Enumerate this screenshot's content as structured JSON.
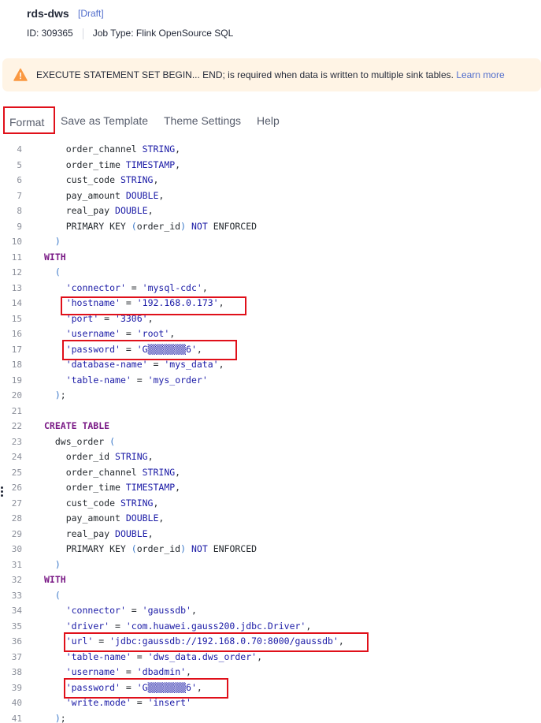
{
  "header": {
    "job_name": "rds-dws",
    "status": "[Draft]",
    "id_text": "ID: 309365",
    "job_type_text": "Job Type: Flink OpenSource SQL"
  },
  "banner": {
    "icon": "warning-icon",
    "message": "EXECUTE STATEMENT SET BEGIN... END; is required when data is written to multiple sink tables.",
    "link": "Learn more",
    "color": "#fff4e5"
  },
  "toolbar": {
    "format": "Format",
    "save_template": "Save as Template",
    "theme_settings": "Theme Settings",
    "help": "Help"
  },
  "editor": {
    "lines": [
      {
        "n": "4",
        "t": "    order_channel STRING,"
      },
      {
        "n": "5",
        "t": "    order_time TIMESTAMP,"
      },
      {
        "n": "6",
        "t": "    cust_code STRING,"
      },
      {
        "n": "7",
        "t": "    pay_amount DOUBLE,"
      },
      {
        "n": "8",
        "t": "    real_pay DOUBLE,"
      },
      {
        "n": "9",
        "t": "    PRIMARY KEY (order_id) NOT ENFORCED"
      },
      {
        "n": "10",
        "t": "  )"
      },
      {
        "n": "11",
        "t": "WITH"
      },
      {
        "n": "12",
        "t": "  ("
      },
      {
        "n": "13",
        "t": "    'connector' = 'mysql-cdc',"
      },
      {
        "n": "14",
        "t": "    'hostname' = '192.168.0.173',"
      },
      {
        "n": "15",
        "t": "    'port' = '3306',"
      },
      {
        "n": "16",
        "t": "    'username' = 'root',"
      },
      {
        "n": "17",
        "t": "    'password' = 'G▒▒▒▒▒▒▒6',"
      },
      {
        "n": "18",
        "t": "    'database-name' = 'mys_data',"
      },
      {
        "n": "19",
        "t": "    'table-name' = 'mys_order'"
      },
      {
        "n": "20",
        "t": "  );"
      },
      {
        "n": "21",
        "t": ""
      },
      {
        "n": "22",
        "t": "CREATE TABLE"
      },
      {
        "n": "23",
        "t": "  dws_order ("
      },
      {
        "n": "24",
        "t": "    order_id STRING,"
      },
      {
        "n": "25",
        "t": "    order_channel STRING,"
      },
      {
        "n": "26",
        "t": "    order_time TIMESTAMP,"
      },
      {
        "n": "27",
        "t": "    cust_code STRING,"
      },
      {
        "n": "28",
        "t": "    pay_amount DOUBLE,"
      },
      {
        "n": "29",
        "t": "    real_pay DOUBLE,"
      },
      {
        "n": "30",
        "t": "    PRIMARY KEY (order_id) NOT ENFORCED"
      },
      {
        "n": "31",
        "t": "  )"
      },
      {
        "n": "32",
        "t": "WITH"
      },
      {
        "n": "33",
        "t": "  ("
      },
      {
        "n": "34",
        "t": "    'connector' = 'gaussdb',"
      },
      {
        "n": "35",
        "t": "    'driver' = 'com.huawei.gauss200.jdbc.Driver',"
      },
      {
        "n": "36",
        "t": "    'url' = 'jdbc:gaussdb://192.168.0.70:8000/gaussdb',"
      },
      {
        "n": "37",
        "t": "    'table-name' = 'dws_data.dws_order',"
      },
      {
        "n": "38",
        "t": "    'username' = 'dbadmin',"
      },
      {
        "n": "39",
        "t": "    'password' = 'G▒▒▒▒▒▒▒6',"
      },
      {
        "n": "40",
        "t": "    'write.mode' = 'insert'"
      },
      {
        "n": "41",
        "t": "  );"
      }
    ]
  }
}
